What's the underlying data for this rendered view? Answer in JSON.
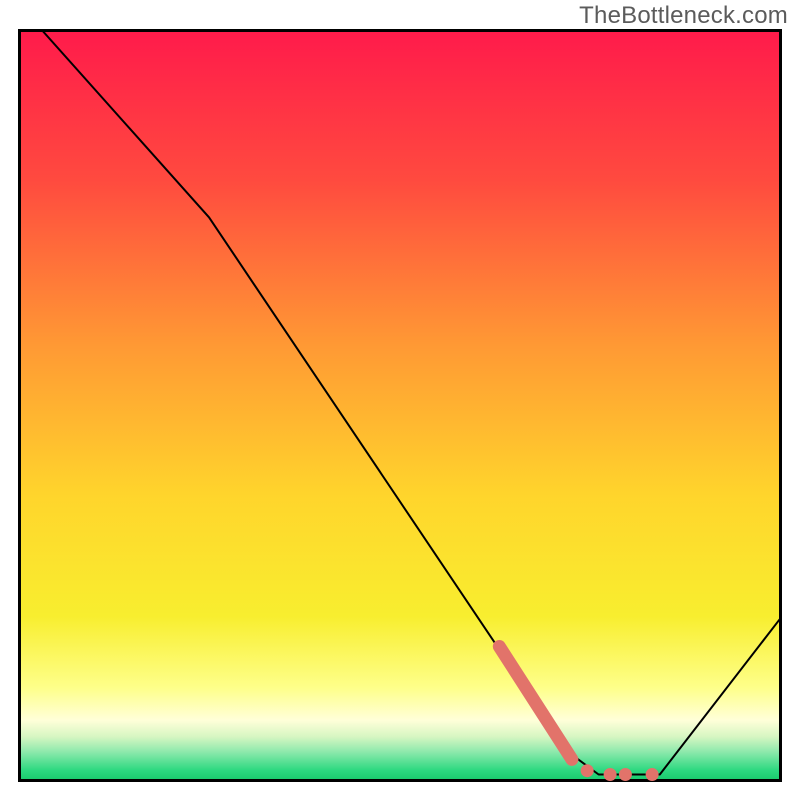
{
  "watermark": "TheBottleneck.com",
  "chart_data": {
    "type": "line",
    "title": "",
    "xlabel": "",
    "ylabel": "",
    "xlim": [
      0,
      100
    ],
    "ylim": [
      0,
      100
    ],
    "grid": false,
    "series": [
      {
        "name": "bottleneck-curve",
        "points": [
          {
            "x": 3,
            "y": 100
          },
          {
            "x": 25,
            "y": 75
          },
          {
            "x": 72,
            "y": 4
          },
          {
            "x": 76,
            "y": 1
          },
          {
            "x": 84,
            "y": 1
          },
          {
            "x": 100,
            "y": 22
          }
        ]
      }
    ],
    "highlight": {
      "name": "target-range-marker",
      "color": "#e2736a",
      "segments": [
        {
          "type": "thick",
          "points": [
            {
              "x": 63,
              "y": 18
            },
            {
              "x": 72.5,
              "y": 3
            }
          ]
        },
        {
          "type": "dots",
          "points": [
            {
              "x": 74.5,
              "y": 1.5
            },
            {
              "x": 77.5,
              "y": 1
            },
            {
              "x": 79.5,
              "y": 1
            },
            {
              "x": 83,
              "y": 1
            }
          ]
        }
      ]
    },
    "background_gradient": {
      "stops": [
        {
          "offset": 0.0,
          "color": "#ff1a4b"
        },
        {
          "offset": 0.2,
          "color": "#ff4a3f"
        },
        {
          "offset": 0.42,
          "color": "#ff9934"
        },
        {
          "offset": 0.62,
          "color": "#ffd52c"
        },
        {
          "offset": 0.78,
          "color": "#f8ee2f"
        },
        {
          "offset": 0.875,
          "color": "#feff8a"
        },
        {
          "offset": 0.918,
          "color": "#ffffd9"
        },
        {
          "offset": 0.94,
          "color": "#d6f6c2"
        },
        {
          "offset": 0.96,
          "color": "#8de9ac"
        },
        {
          "offset": 0.985,
          "color": "#2bd87f"
        },
        {
          "offset": 1.0,
          "color": "#15c86a"
        }
      ]
    }
  }
}
